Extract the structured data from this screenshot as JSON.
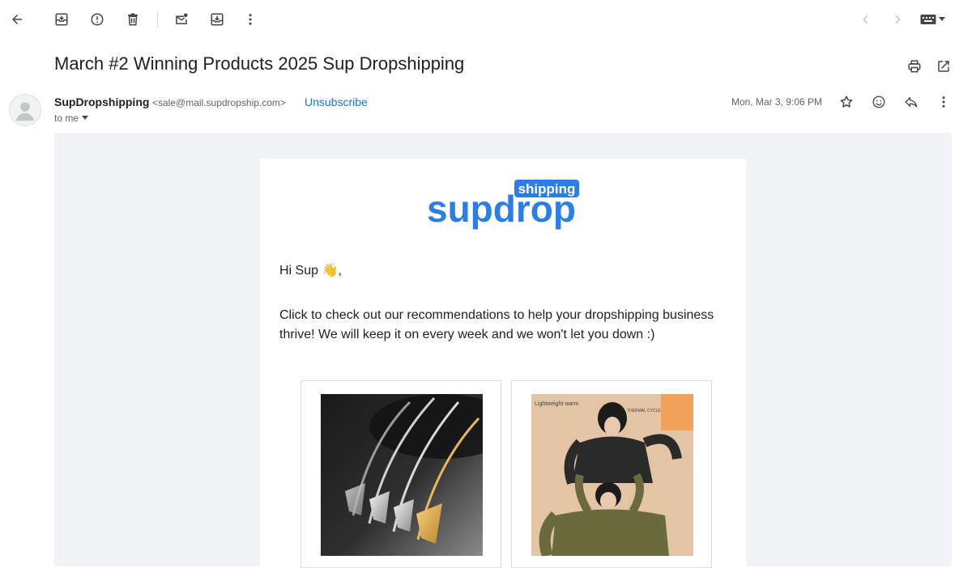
{
  "toolbar": {
    "icons": [
      "back-arrow-icon",
      "archive-icon",
      "report-spam-icon",
      "delete-icon",
      "mark-unread-icon",
      "move-to-icon",
      "more-vert-icon"
    ],
    "pager_icons": [
      "chevron-left-icon",
      "chevron-right-icon"
    ],
    "keyboard_icon": "keyboard-icon"
  },
  "message": {
    "subject": "March #2 Winning Products 2025 Sup Dropshipping",
    "sender_name": "SupDropshipping",
    "sender_email": "<sale@mail.supdropship.com>",
    "unsubscribe_label": "Unsubscribe",
    "recipient_label": "to me",
    "date": "Mon, Mar 3, 9:06 PM"
  },
  "email": {
    "logo_main": "supdrop",
    "logo_tag": "shipping",
    "greeting": "Hi Sup 👋,",
    "body": "Click to check out our recommendations to help your dropshipping business thrive! We will keep it on every week and we won't let you down :)",
    "products": [
      {
        "image": "arrowhead-pendant-necklaces"
      },
      {
        "image": "thermal-shirt-women",
        "caption_lines": [
          "Lightweight warm",
          "THERMAL CYCLE"
        ]
      }
    ]
  },
  "colors": {
    "brand_blue": "#2b7de9",
    "link_blue": "#1a73e8",
    "email_bg": "#f1f3f6"
  }
}
